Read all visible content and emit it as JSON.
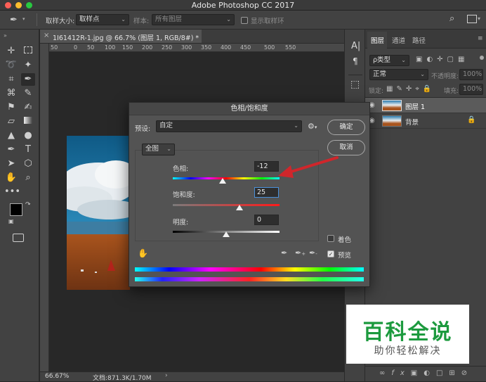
{
  "window": {
    "title": "Adobe Photoshop CC 2017"
  },
  "options_bar": {
    "sample_size_label": "取样大小:",
    "sample_size_value": "取样点",
    "sample_label": "样本:",
    "sample_value": "所有图层",
    "show_ring_label": "显示取样环"
  },
  "document": {
    "tab_title": "1I61412R-1.jpg @ 66.7% (图层 1, RGB/8#) *",
    "ruler_numbers": [
      "50",
      "0",
      "50",
      "100",
      "150",
      "200",
      "250",
      "300",
      "350",
      "400",
      "450",
      "500",
      "550"
    ],
    "zoom": "66.67%",
    "doc_info": "文档:871.3K/1.70M"
  },
  "layers_panel": {
    "tabs": [
      "图层",
      "通道",
      "路径"
    ],
    "kind_filter": "ρ类型",
    "blend_mode": "正常",
    "opacity_label": "不透明度:",
    "opacity_value": "100%",
    "lock_label": "锁定:",
    "fill_label": "填充:",
    "fill_value": "100%",
    "layers": [
      {
        "name": "图层 1"
      },
      {
        "name": "背景"
      }
    ]
  },
  "dialog": {
    "title": "色相/饱和度",
    "preset_label": "预设:",
    "preset_value": "自定",
    "ok_label": "确定",
    "cancel_label": "取消",
    "channel_value": "全图",
    "hue_label": "色相:",
    "hue_value": "-12",
    "saturation_label": "饱和度:",
    "saturation_value": "25",
    "lightness_label": "明度:",
    "lightness_value": "0",
    "colorize_label": "着色",
    "preview_label": "预览",
    "colorize_checked": false,
    "preview_checked": true,
    "hue_slider_fraction": 0.47,
    "saturation_slider_fraction": 0.625,
    "lightness_slider_fraction": 0.5
  },
  "watermark": {
    "main_text": "百科全说",
    "sub_text": "助你轻松解决"
  },
  "colors": {
    "annotation_arrow": "#d0262b",
    "watermark_green": "#1c9a3e"
  }
}
